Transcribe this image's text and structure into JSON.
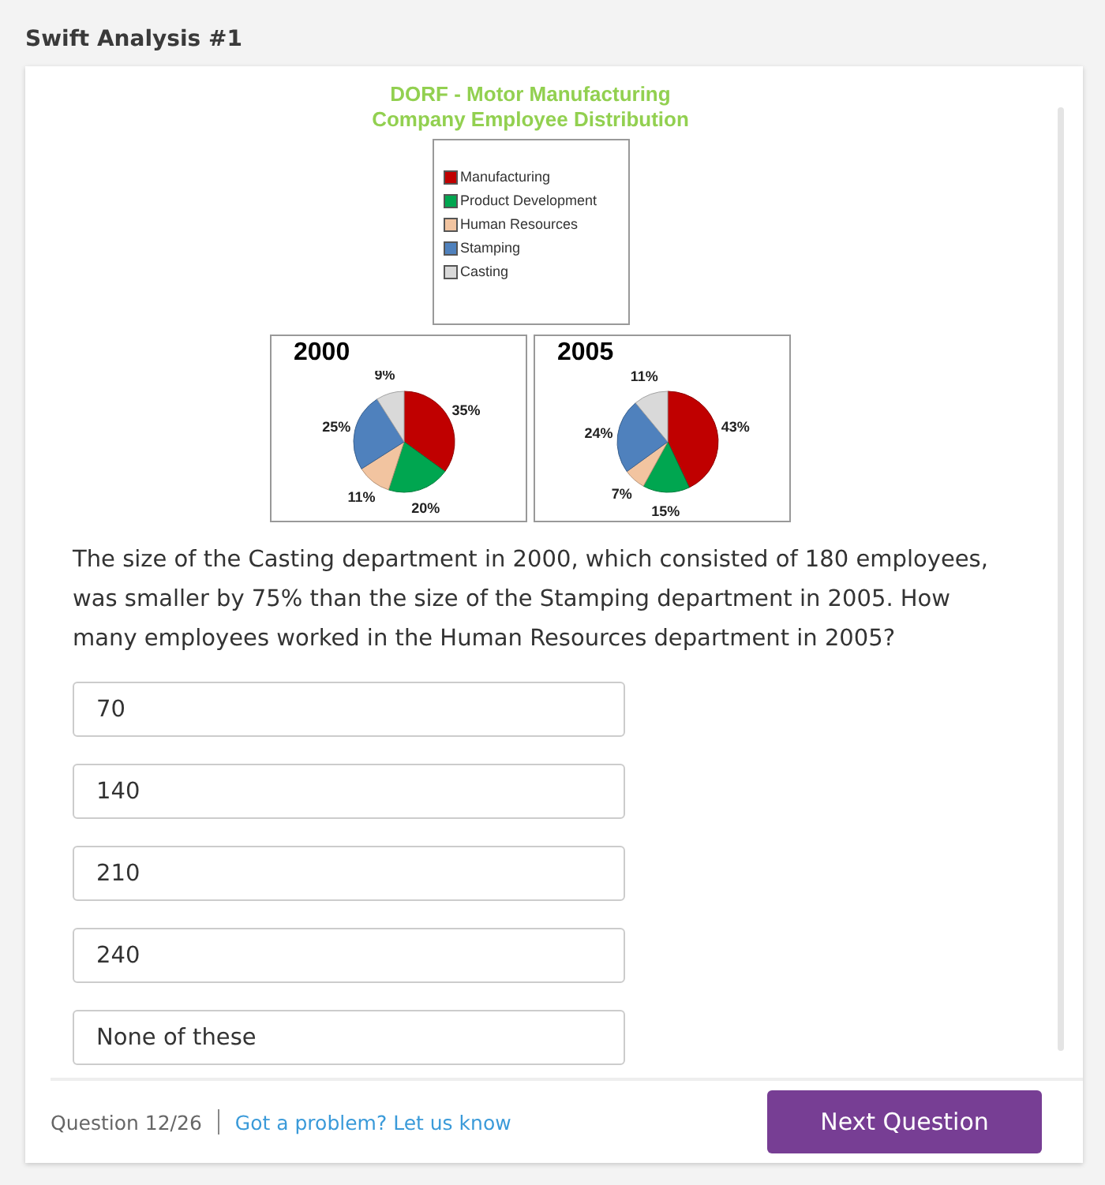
{
  "header": {
    "title": "Swift Analysis #1"
  },
  "figure": {
    "title_lines": [
      "DORF - Motor Manufacturing",
      "Company Employee Distribution"
    ],
    "legend": [
      {
        "label": "Manufacturing",
        "color": "#c00000"
      },
      {
        "label": "Product Development",
        "color": "#00a650"
      },
      {
        "label": "Human Resources",
        "color": "#f2c4a0"
      },
      {
        "label": "Stamping",
        "color": "#4f81bd"
      },
      {
        "label": "Casting",
        "color": "#d9d9d9"
      }
    ],
    "charts": [
      {
        "chart_data": {
          "type": "pie",
          "title": "2000",
          "values": [
            35,
            20,
            11,
            25,
            9
          ],
          "value_labels": [
            "35%",
            "20%",
            "11%",
            "25%",
            "9%"
          ]
        }
      },
      {
        "chart_data": {
          "type": "pie",
          "title": "2005",
          "values": [
            43,
            15,
            7,
            24,
            11
          ],
          "value_labels": [
            "43%",
            "15%",
            "7%",
            "24%",
            "11%"
          ]
        }
      }
    ]
  },
  "question": "The size of the Casting department in 2000, which consisted of 180 employees, was smaller by 75% than the size of the Stamping department in 2005. How many employees worked in the Human Resources department in 2005?",
  "options": [
    {
      "label": "70"
    },
    {
      "label": "140"
    },
    {
      "label": "210"
    },
    {
      "label": "240"
    },
    {
      "label": "None of these"
    }
  ],
  "footer": {
    "progress": "Question 12/26",
    "link": "Got a problem? Let us know",
    "button": "Next Question"
  }
}
